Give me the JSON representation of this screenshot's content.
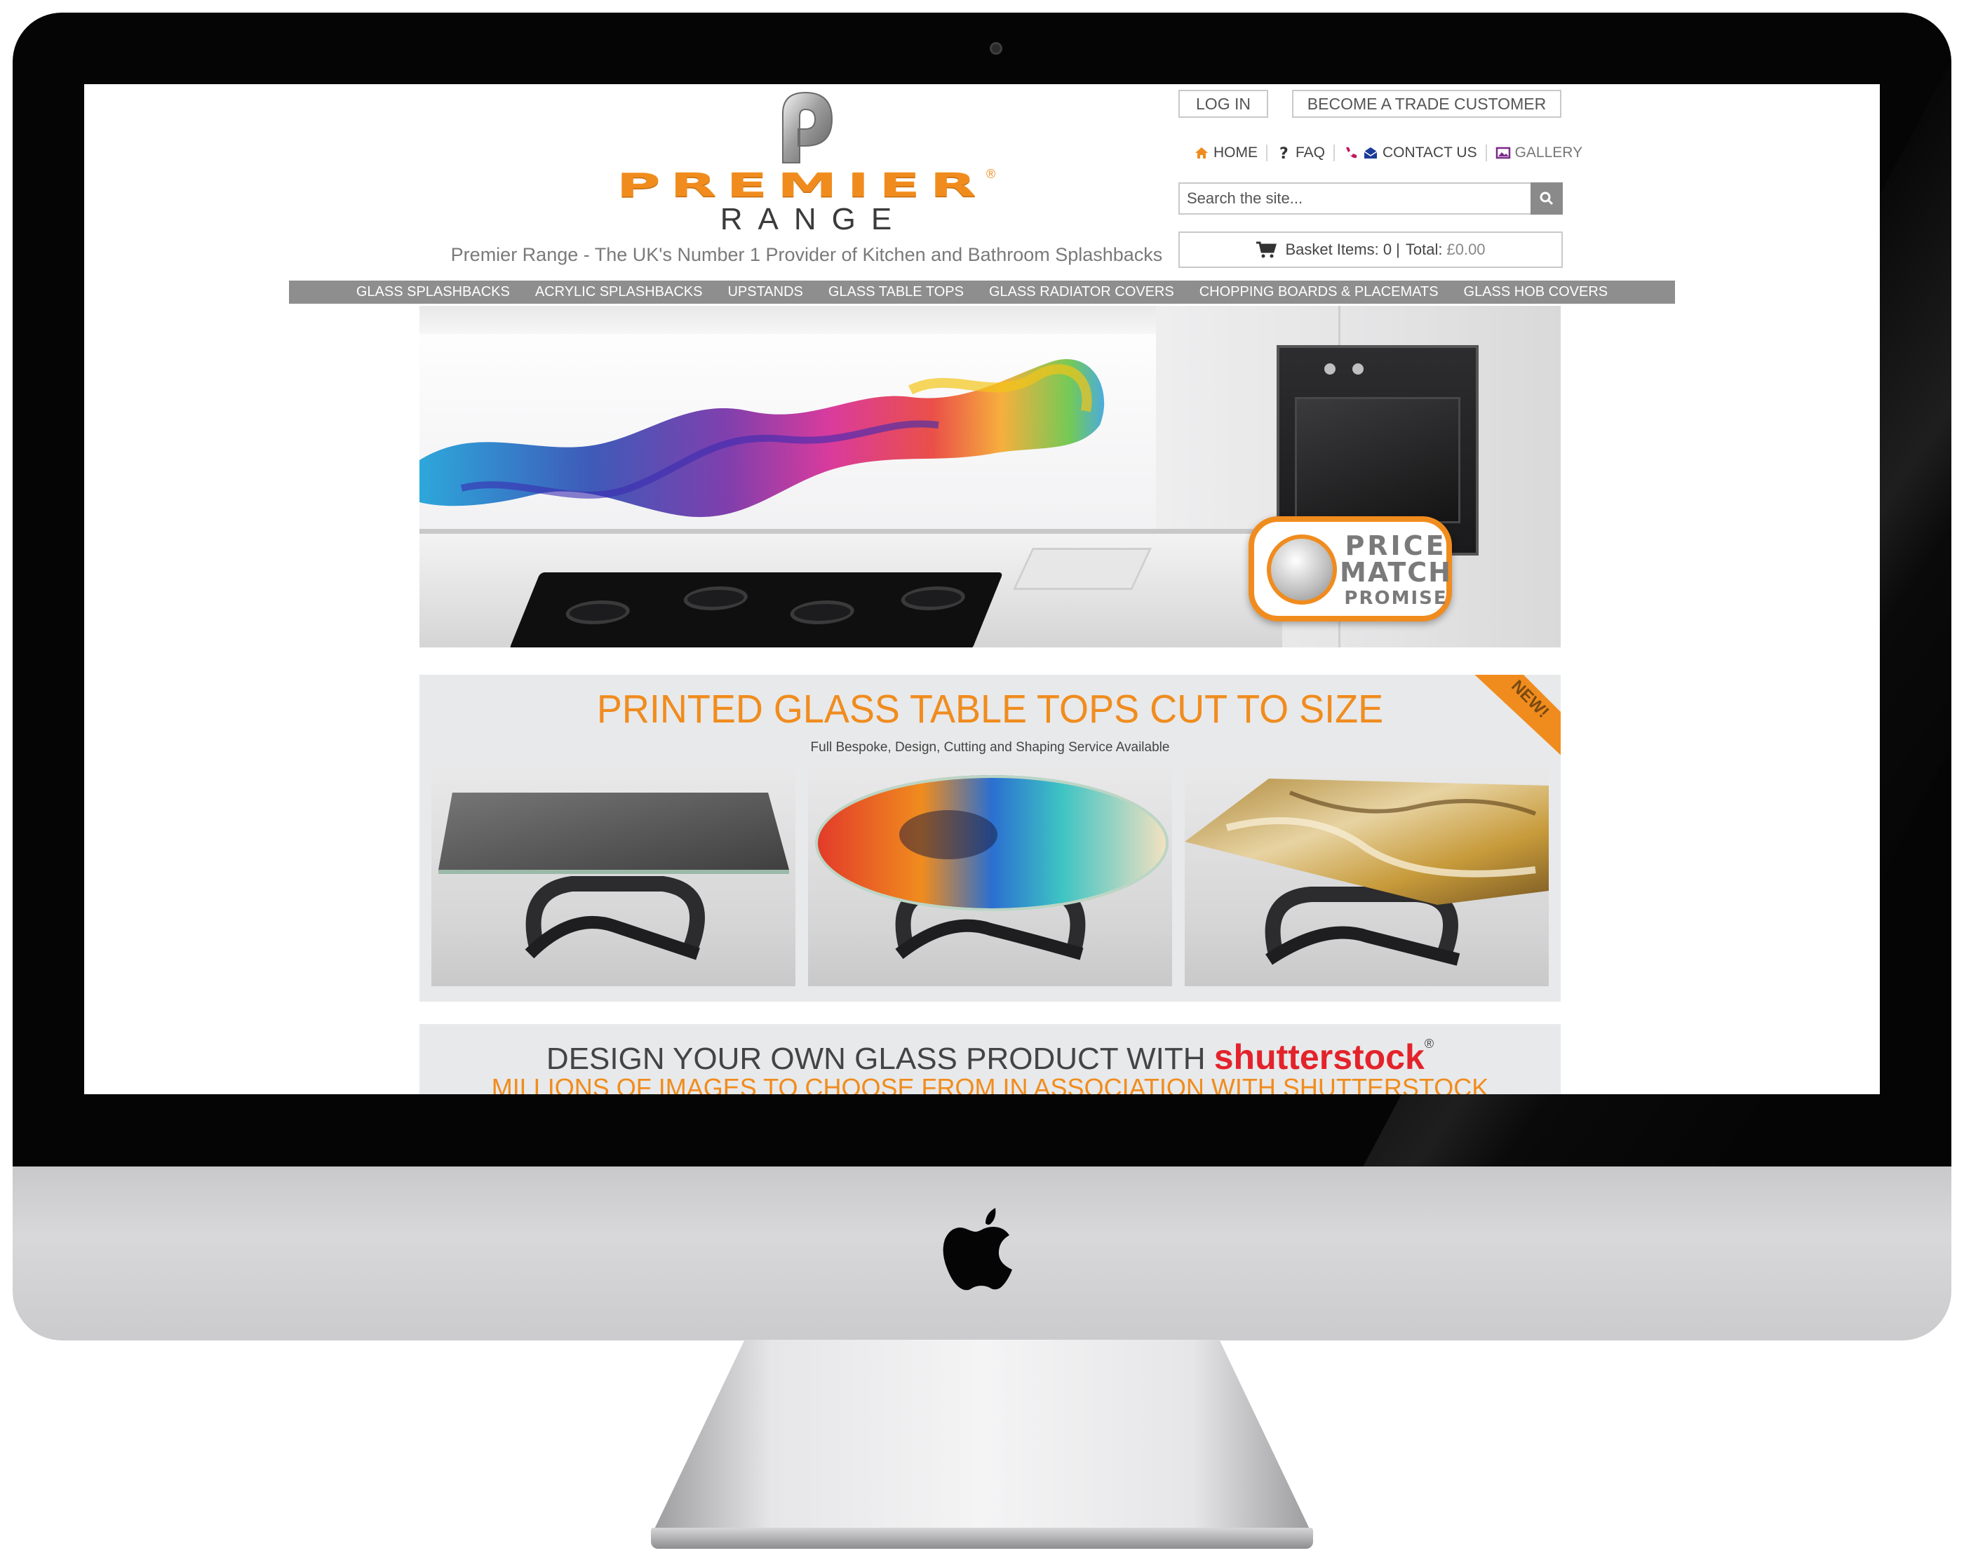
{
  "colors": {
    "brand_orange": "#f08c1e",
    "nav_bg": "#8e8e8e",
    "promo_bg": "#e8e9ea",
    "shutterstock_red": "#e3232b"
  },
  "header": {
    "logo_word": "PREMIER",
    "logo_range": "RANGE",
    "logo_registered": "®",
    "tagline": "Premier Range - The UK's Number 1 Provider of Kitchen and Bathroom Splashbacks"
  },
  "account": {
    "login_label": "LOG IN",
    "trade_label": "BECOME A TRADE CUSTOMER"
  },
  "quicknav": {
    "home": "HOME",
    "faq": "FAQ",
    "contact": "CONTACT US",
    "gallery": "GALLERY"
  },
  "search": {
    "placeholder": "Search the site...",
    "icon": "search-icon"
  },
  "basket": {
    "items_label": "Basket Items: 0 |",
    "total_label": "Total:",
    "total_value": "£0.00",
    "icon": "cart-icon"
  },
  "mainnav": {
    "items": [
      "GLASS SPLASHBACKS",
      "ACRYLIC SPLASHBACKS",
      "UPSTANDS",
      "GLASS TABLE TOPS",
      "GLASS RADIATOR COVERS",
      "CHOPPING BOARDS & PLACEMATS",
      "GLASS HOB COVERS"
    ]
  },
  "hero": {
    "badge_line1": "PRICE",
    "badge_line2": "MATCH",
    "badge_line3": "PROMISE"
  },
  "promo": {
    "title": "PRINTED GLASS TABLE TOPS CUT TO SIZE",
    "subtitle": "Full Bespoke, Design, Cutting and Shaping Service Available",
    "ribbon": "NEW!"
  },
  "shutterstock": {
    "line1": "DESIGN YOUR OWN GLASS PRODUCT WITH",
    "brand": "shutterstock",
    "brand_mark": "®",
    "line2": "MILLIONS OF IMAGES TO CHOOSE FROM IN ASSOCIATION WITH SHUTTERSTOCK"
  }
}
